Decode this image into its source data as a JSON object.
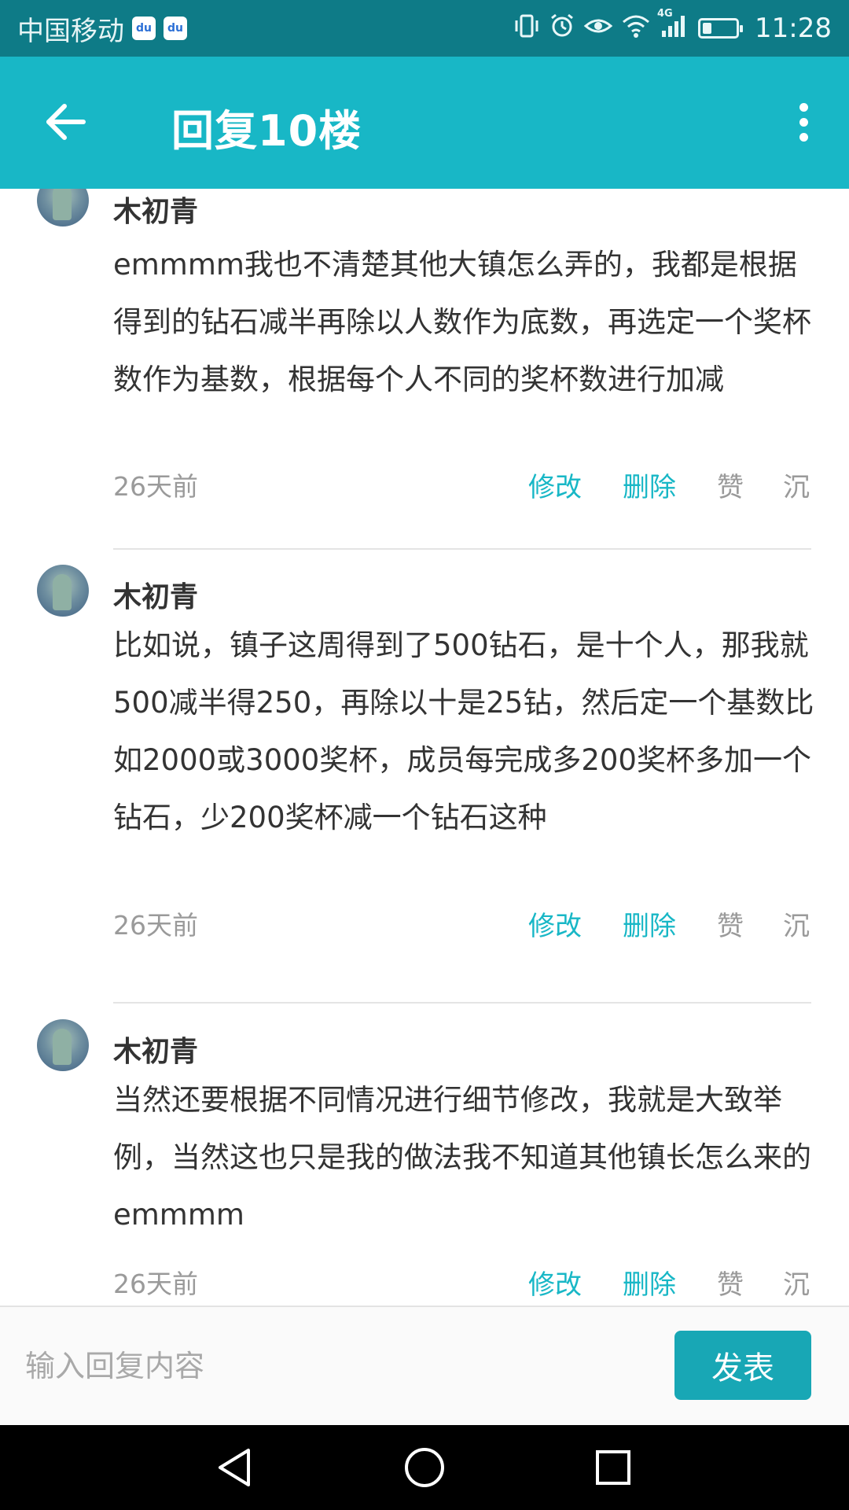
{
  "status_bar": {
    "carrier": "中国移动",
    "app_badges": [
      "du",
      "du"
    ],
    "network_label": "4G",
    "time": "11:28",
    "battery_level": 0.3,
    "icons": [
      "vibrate-icon",
      "alarm-icon",
      "eye-icon",
      "wifi-icon",
      "signal-icon",
      "battery-icon"
    ]
  },
  "header": {
    "title": "回复10楼",
    "back_icon": "arrow-left-icon",
    "more_icon": "more-vertical-icon"
  },
  "replies": [
    {
      "user": "木初青",
      "text": "emmmm我也不清楚其他大镇怎么弄的，我都是根据得到的钻石减半再除以人数作为底数，再选定一个奖杯数作为基数，根据每个人不同的奖杯数进行加减",
      "time": "26天前",
      "actions": {
        "edit": "修改",
        "delete": "删除",
        "like": "赞",
        "sink": "沉"
      }
    },
    {
      "user": "木初青",
      "text": "比如说，镇子这周得到了500钻石，是十个人，那我就500减半得250，再除以十是25钻，然后定一个基数比如2000或3000奖杯，成员每完成多200奖杯多加一个钻石，少200奖杯减一个钻石这种",
      "time": "26天前",
      "actions": {
        "edit": "修改",
        "delete": "删除",
        "like": "赞",
        "sink": "沉"
      }
    },
    {
      "user": "木初青",
      "text": "当然还要根据不同情况进行细节修改，我就是大致举例，当然这也只是我的做法我不知道其他镇长怎么来的emmmm",
      "time": "26天前",
      "actions": {
        "edit": "修改",
        "delete": "删除",
        "like": "赞",
        "sink": "沉"
      }
    }
  ],
  "input_bar": {
    "placeholder": "输入回复内容",
    "value": "",
    "submit_label": "发表"
  },
  "nav_bar": {
    "icons": [
      "nav-back-icon",
      "nav-home-icon",
      "nav-recent-icon"
    ]
  },
  "colors": {
    "status_bar": "#0e7b87",
    "header": "#18b7c6",
    "accent": "#18b7c6",
    "button": "#18a7b5",
    "muted_text": "#9a9a9a",
    "body_text": "#333333"
  }
}
